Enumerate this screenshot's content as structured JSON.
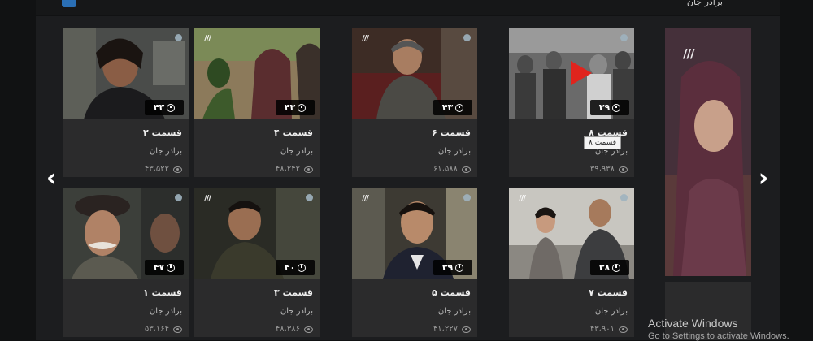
{
  "top_bar": {
    "title": "برادر جان"
  },
  "episodes": [
    {
      "title": "قسمت ۲",
      "series": "برادر جان",
      "views": "۴۳،۵۲۲",
      "duration": "۴۳"
    },
    {
      "title": "قسمت ۴",
      "series": "برادر جان",
      "views": "۴۸،۲۴۲",
      "duration": "۴۳"
    },
    {
      "title": "قسمت ۶",
      "series": "برادر جان",
      "views": "۶۱،۵۸۸",
      "duration": "۴۳"
    },
    {
      "title": "قسمت ۸",
      "series": "برادر جان",
      "views": "۳۹،۹۳۸",
      "duration": "۳۹"
    },
    {
      "title": "قسمت ۱",
      "series": "برادر جان",
      "views": "۵۳،۱۶۴",
      "duration": "۴۷"
    },
    {
      "title": "قسمت ۳",
      "series": "برادر جان",
      "views": "۴۸،۳۸۶",
      "duration": "۴۰"
    },
    {
      "title": "قسمت ۵",
      "series": "برادر جان",
      "views": "۴۱،۲۲۷",
      "duration": "۳۹"
    },
    {
      "title": "قسمت ۷",
      "series": "برادر جان",
      "views": "۴۳،۹۰۱",
      "duration": "۳۸"
    }
  ],
  "tooltip": "قسمت ۸",
  "nav": {
    "prev": "‹",
    "next": "›"
  },
  "channel_logo": "///",
  "watermark": {
    "line1": "Activate Windows",
    "line2": "Go to Settings to activate Windows."
  }
}
